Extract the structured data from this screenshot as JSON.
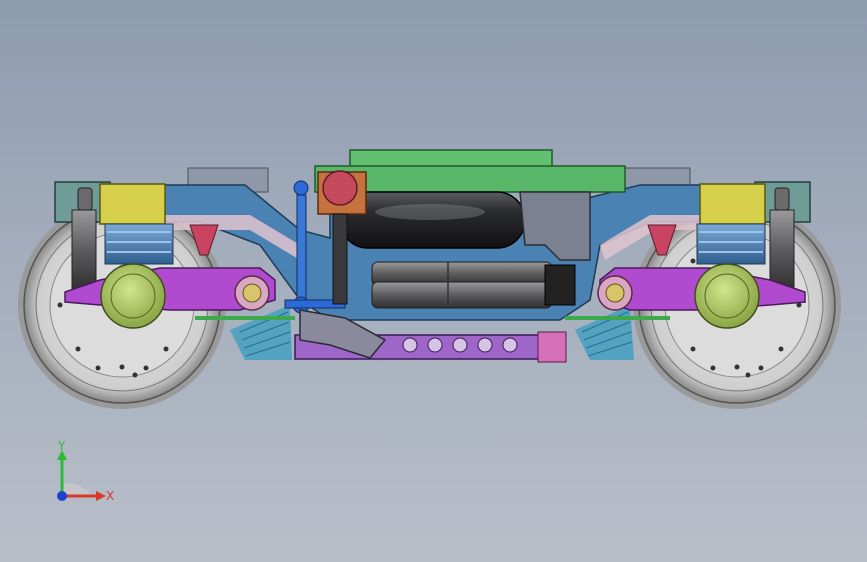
{
  "viewport": {
    "background_top": "#8d9bb0",
    "background_bottom": "#b9bfc9"
  },
  "model": {
    "subject": "bogie-assembly",
    "colors": {
      "wheel": "#d9d9d9",
      "axle_box": "#b9d36a",
      "primary_arm": "#b04bd0",
      "spring_cap": "#d6cf4a",
      "frame": "#4a83b3",
      "frame_end": "#6f9c97",
      "air_spring": "#3d6f9e",
      "tank_top": "#62c171",
      "air_tank": "#222325",
      "cylinder": "#6d6d6f",
      "crossbeam": "#9d66c8",
      "link_blue": "#3a78d6"
    }
  },
  "triad": {
    "y_label": "Y",
    "x_label": "X",
    "y_color": "#2fb83a",
    "x_color": "#d83a2a",
    "z_color": "#1f3fcf"
  }
}
